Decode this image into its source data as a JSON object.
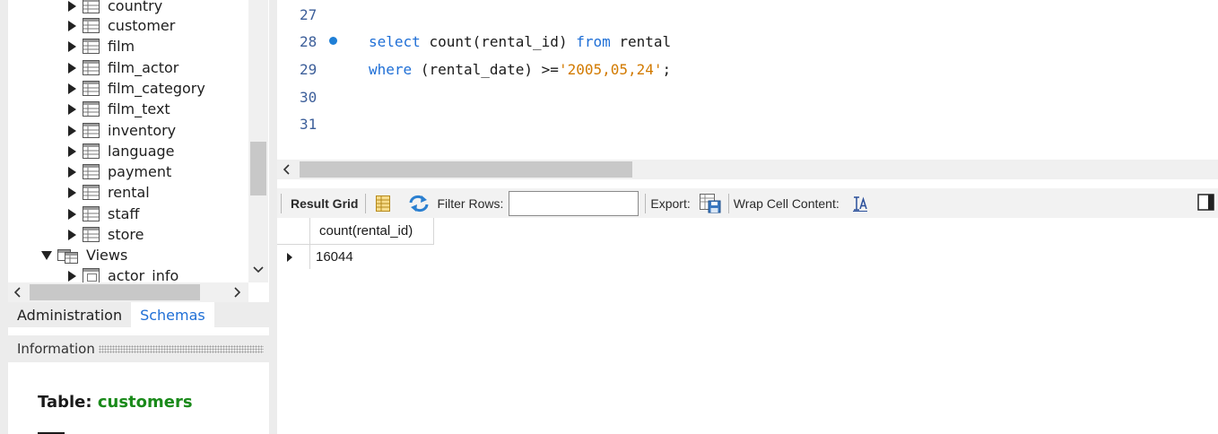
{
  "navigator": {
    "tables": [
      {
        "label": "country"
      },
      {
        "label": "customer"
      },
      {
        "label": "film"
      },
      {
        "label": "film_actor"
      },
      {
        "label": "film_category"
      },
      {
        "label": "film_text"
      },
      {
        "label": "inventory"
      },
      {
        "label": "language"
      },
      {
        "label": "payment"
      },
      {
        "label": "rental"
      },
      {
        "label": "staff"
      },
      {
        "label": "store"
      }
    ],
    "views_label": "Views",
    "views": [
      {
        "label": "actor_info"
      }
    ],
    "tabs": {
      "administration": "Administration",
      "schemas": "Schemas"
    },
    "active_tab": "Schemas"
  },
  "information": {
    "title": "Information",
    "table_label": "Table:",
    "table_name": "customers"
  },
  "editor": {
    "lines": [
      {
        "num": "27",
        "text": ""
      },
      {
        "num": "28",
        "marker": true
      },
      {
        "num": "29"
      },
      {
        "num": "30",
        "text": ""
      },
      {
        "num": "31",
        "text": ""
      }
    ],
    "line28": {
      "select": "select",
      "count": "count",
      "arg": "(rental_id)",
      "from": "from",
      "table": "rental"
    },
    "line29": {
      "where": "where",
      "cond": "(rental_date) >=",
      "value": "'2005,05,24'",
      "end": ";"
    }
  },
  "result_toolbar": {
    "result_grid_label": "Result Grid",
    "filter_rows_label": "Filter Rows:",
    "filter_value": "",
    "export_label": "Export:",
    "wrap_label": "Wrap Cell Content:"
  },
  "result": {
    "columns": [
      "count(rental_id)"
    ],
    "rows": [
      [
        "16044"
      ]
    ]
  },
  "colors": {
    "keyword": "#1f6fd6",
    "string": "#d27a00",
    "active_tab": "#1f6fd6",
    "table_name": "#1a8a1a"
  }
}
